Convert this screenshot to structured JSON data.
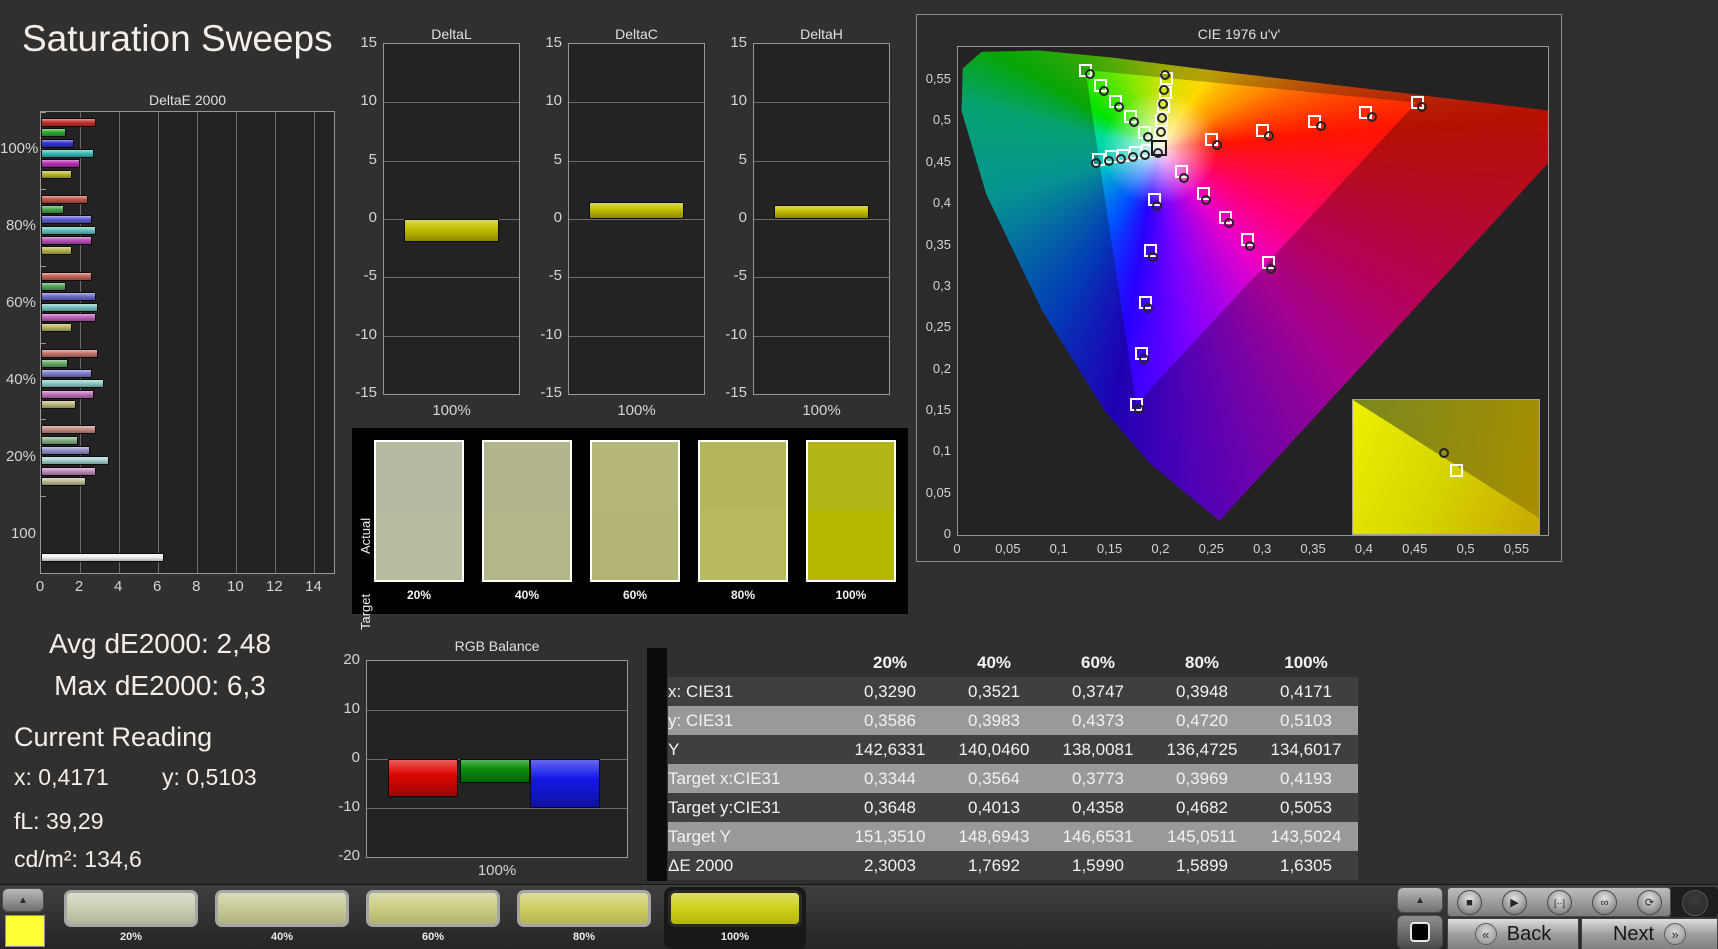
{
  "title": "Saturation Sweeps",
  "stats": {
    "avg": "Avg dE2000: 2,48",
    "max": "Max dE2000: 6,3",
    "current_heading": "Current Reading",
    "x": "x: 0,4171",
    "y": "y: 0,5103",
    "fl": "fL: 39,29",
    "cdm": "cd/m²: 134,6"
  },
  "chart_data": [
    {
      "id": "deltae2000",
      "type": "bar",
      "orientation": "horizontal",
      "title": "DeltaE 2000",
      "xlim": [
        0,
        15
      ],
      "xticks": [
        0,
        2,
        4,
        6,
        8,
        10,
        12,
        14
      ],
      "groups": [
        {
          "label": "100%",
          "values": [
            2.8,
            1.3,
            1.7,
            2.7,
            2.0,
            1.6
          ],
          "colors": [
            "#c53228",
            "#2ea832",
            "#3333cf",
            "#39bdb9",
            "#bb30b5",
            "#b9b52e"
          ]
        },
        {
          "label": "80%",
          "values": [
            2.4,
            1.2,
            2.6,
            2.8,
            2.6,
            1.6
          ],
          "colors": [
            "#c4554b",
            "#48a84c",
            "#5e5ed2",
            "#62c2be",
            "#bc51b8",
            "#b8b44c"
          ]
        },
        {
          "label": "60%",
          "values": [
            2.6,
            1.3,
            2.8,
            2.9,
            2.8,
            1.6
          ],
          "colors": [
            "#c5625a",
            "#55a858",
            "#6e6ed0",
            "#74c4c0",
            "#bd62ba",
            "#bab660"
          ]
        },
        {
          "label": "40%",
          "values": [
            2.9,
            1.4,
            2.6,
            3.2,
            2.7,
            1.8
          ],
          "colors": [
            "#c6746c",
            "#66aa68",
            "#7d7dce",
            "#8cccc8",
            "#be74bc",
            "#bcb878"
          ]
        },
        {
          "label": "20%",
          "values": [
            2.8,
            1.9,
            2.5,
            3.5,
            2.8,
            2.3
          ],
          "colors": [
            "#c88a84",
            "#84b286",
            "#9292cc",
            "#a8d2d0",
            "#c08cbe",
            "#c0bc96"
          ]
        },
        {
          "label": "100",
          "values": [
            6.3
          ],
          "colors": [
            "#f0f0f0"
          ]
        }
      ]
    },
    {
      "id": "deltaL",
      "type": "bar",
      "title": "DeltaL",
      "ylim": [
        -15,
        15
      ],
      "yticks": [
        15,
        10,
        5,
        0,
        -5,
        -10,
        -15
      ],
      "categories": [
        "100%"
      ],
      "values": [
        -2.0
      ],
      "bar_color": "#c6c200"
    },
    {
      "id": "deltaC",
      "type": "bar",
      "title": "DeltaC",
      "ylim": [
        -15,
        15
      ],
      "yticks": [
        15,
        10,
        5,
        0,
        -5,
        -10,
        -15
      ],
      "categories": [
        "100%"
      ],
      "values": [
        1.5
      ],
      "bar_color": "#c6c200"
    },
    {
      "id": "deltaH",
      "type": "bar",
      "title": "DeltaH",
      "ylim": [
        -15,
        15
      ],
      "yticks": [
        15,
        10,
        5,
        0,
        -5,
        -10,
        -15
      ],
      "categories": [
        "100%"
      ],
      "values": [
        1.2
      ],
      "bar_color": "#c6c200"
    },
    {
      "id": "rgb_balance",
      "type": "bar",
      "title": "RGB Balance",
      "ylim": [
        -20,
        20
      ],
      "yticks": [
        20,
        10,
        0,
        -10,
        -20
      ],
      "categories": [
        "100%"
      ],
      "series": [
        {
          "name": "Red",
          "value": -7.8,
          "color": "#dd0800"
        },
        {
          "name": "Green",
          "value": -4.8,
          "color": "#0b8c0b"
        },
        {
          "name": "Blue",
          "value": -10.0,
          "color": "#1418e8"
        }
      ]
    },
    {
      "id": "cie1976",
      "type": "scatter",
      "title": "CIE 1976 u'v'",
      "xlim": [
        0,
        0.58
      ],
      "ylim": [
        0,
        0.59
      ],
      "xtick_labels": [
        "0",
        "0,05",
        "0,1",
        "0,15",
        "0,2",
        "0,25",
        "0,3",
        "0,35",
        "0,4",
        "0,45",
        "0,5",
        "0,55"
      ],
      "ytick_labels": [
        "0,55",
        "0,5",
        "0,45",
        "0,4",
        "0,35",
        "0,3",
        "0,25",
        "0,2",
        "0,15",
        "0,1",
        "0,05",
        "0"
      ],
      "targets": {
        "red": [
          [
            0.249,
            0.479
          ],
          [
            0.299,
            0.49
          ],
          [
            0.35,
            0.501
          ],
          [
            0.4,
            0.512
          ],
          [
            0.451,
            0.523
          ]
        ],
        "green": [
          [
            0.183,
            0.487
          ],
          [
            0.169,
            0.506
          ],
          [
            0.154,
            0.525
          ],
          [
            0.14,
            0.544
          ],
          [
            0.125,
            0.562
          ]
        ],
        "blue": [
          [
            0.193,
            0.406
          ],
          [
            0.189,
            0.344
          ],
          [
            0.184,
            0.282
          ],
          [
            0.18,
            0.22
          ],
          [
            0.175,
            0.158
          ]
        ],
        "cyan": [
          [
            0.186,
            0.465
          ],
          [
            0.174,
            0.463
          ],
          [
            0.162,
            0.46
          ],
          [
            0.15,
            0.458
          ],
          [
            0.138,
            0.455
          ]
        ],
        "magenta": [
          [
            0.219,
            0.44
          ],
          [
            0.241,
            0.413
          ],
          [
            0.262,
            0.385
          ],
          [
            0.284,
            0.358
          ],
          [
            0.305,
            0.33
          ]
        ],
        "yellow": [
          [
            0.199,
            0.485
          ],
          [
            0.2,
            0.502
          ],
          [
            0.202,
            0.519
          ],
          [
            0.203,
            0.536
          ],
          [
            0.204,
            0.553
          ]
        ]
      },
      "measured": {
        "red": [
          [
            0.255,
            0.472
          ],
          [
            0.306,
            0.483
          ],
          [
            0.357,
            0.494
          ],
          [
            0.407,
            0.505
          ],
          [
            0.456,
            0.517
          ]
        ],
        "green": [
          [
            0.187,
            0.481
          ],
          [
            0.173,
            0.499
          ],
          [
            0.158,
            0.518
          ],
          [
            0.144,
            0.537
          ],
          [
            0.13,
            0.557
          ]
        ],
        "blue": [
          [
            0.196,
            0.398
          ],
          [
            0.192,
            0.336
          ],
          [
            0.187,
            0.274
          ],
          [
            0.183,
            0.213
          ],
          [
            0.178,
            0.152
          ]
        ],
        "cyan": [
          [
            0.184,
            0.459
          ],
          [
            0.172,
            0.457
          ],
          [
            0.16,
            0.455
          ],
          [
            0.148,
            0.452
          ],
          [
            0.136,
            0.45
          ]
        ],
        "magenta": [
          [
            0.222,
            0.432
          ],
          [
            0.244,
            0.405
          ],
          [
            0.266,
            0.377
          ],
          [
            0.287,
            0.35
          ],
          [
            0.308,
            0.322
          ]
        ],
        "yellow": [
          [
            0.2,
            0.487
          ],
          [
            0.201,
            0.504
          ],
          [
            0.2015,
            0.521
          ],
          [
            0.2025,
            0.538
          ],
          [
            0.2035,
            0.556
          ]
        ]
      },
      "white_target": [
        0.198,
        0.468
      ],
      "white_measured": [
        0.197,
        0.462
      ],
      "inset": {
        "circle": [
          46,
          36
        ],
        "square": [
          52,
          48
        ]
      }
    }
  ],
  "swatch_panel": {
    "row_labels": [
      "Actual",
      "Target"
    ],
    "labels": [
      "20%",
      "40%",
      "60%",
      "80%",
      "100%"
    ],
    "actual": [
      "#b7baa3",
      "#b2b58c",
      "#b4b778",
      "#b3b65d",
      "#b1b414"
    ],
    "target": [
      "#babc9f",
      "#b4b689",
      "#b3b574",
      "#b7b95d",
      "#b5b800"
    ]
  },
  "table": {
    "col_headers": [
      "20%",
      "40%",
      "60%",
      "80%",
      "100%"
    ],
    "rows": [
      {
        "label": "x: CIE31",
        "values": [
          "0,3290",
          "0,3521",
          "0,3747",
          "0,3948",
          "0,4171"
        ],
        "shade": "dark"
      },
      {
        "label": "y: CIE31",
        "values": [
          "0,3586",
          "0,3983",
          "0,4373",
          "0,4720",
          "0,5103"
        ],
        "shade": "light"
      },
      {
        "label": "Y",
        "values": [
          "142,6331",
          "140,0460",
          "138,0081",
          "136,4725",
          "134,6017"
        ],
        "shade": "dark"
      },
      {
        "label": "Target x:CIE31",
        "values": [
          "0,3344",
          "0,3564",
          "0,3773",
          "0,3969",
          "0,4193"
        ],
        "shade": "light"
      },
      {
        "label": "Target y:CIE31",
        "values": [
          "0,3648",
          "0,4013",
          "0,4358",
          "0,4682",
          "0,5053"
        ],
        "shade": "dark"
      },
      {
        "label": "Target Y",
        "values": [
          "151,3510",
          "148,6943",
          "146,6531",
          "145,0511",
          "143,5024"
        ],
        "shade": "light"
      },
      {
        "label": "ΔE 2000",
        "values": [
          "2,3003",
          "1,7692",
          "1,5990",
          "1,5899",
          "1,6305"
        ],
        "shade": "dark"
      }
    ]
  },
  "bottom_bar": {
    "swatches": [
      {
        "label": "20%",
        "color": "#c9cbb0",
        "selected": false
      },
      {
        "label": "40%",
        "color": "#c7c894",
        "selected": false
      },
      {
        "label": "60%",
        "color": "#c9cb7e",
        "selected": false
      },
      {
        "label": "80%",
        "color": "#cccd61",
        "selected": false
      },
      {
        "label": "100%",
        "color": "#cbce14",
        "selected": true
      }
    ],
    "current_patch_color": "#ffff36",
    "up_arrow": "▲",
    "toolbar_icons": [
      {
        "name": "stop-icon",
        "glyph": "■"
      },
      {
        "name": "play-icon",
        "glyph": "▶"
      },
      {
        "name": "range-icon",
        "glyph": "[··]"
      },
      {
        "name": "continuous-icon",
        "glyph": "∞"
      },
      {
        "name": "refresh-icon",
        "glyph": "⟳"
      }
    ],
    "back_label": "Back",
    "next_label": "Next",
    "back_chevron": "«",
    "next_chevron": "»"
  }
}
